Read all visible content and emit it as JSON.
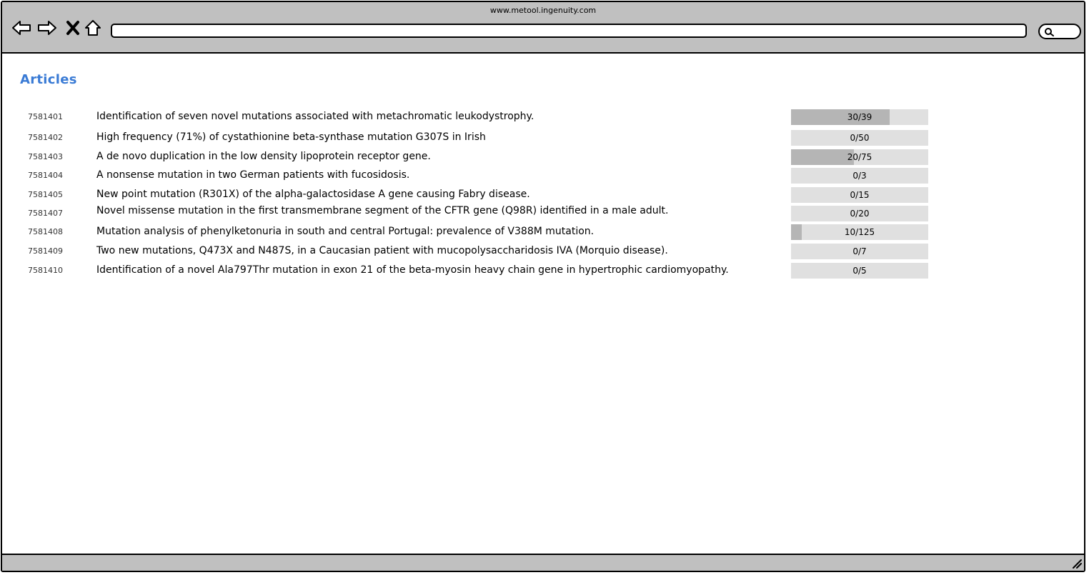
{
  "browser": {
    "url_caption": "www.metool.ingenuity.com",
    "address_value": "",
    "icons": [
      "back-arrow-icon",
      "forward-arrow-icon",
      "stop-icon",
      "home-icon",
      "search-icon",
      "resize-grip-icon"
    ]
  },
  "page": {
    "heading": "Articles",
    "heading_color": "#3a7bd5"
  },
  "articles": [
    {
      "id": "7581401",
      "title": "Identification of seven novel mutations associated with metachromatic leukodystrophy.",
      "progress_label": "30/39",
      "progress_fraction": 0.72
    },
    {
      "id": "7581402",
      "title": "High frequency (71%) of cystathionine beta-synthase mutation G307S in Irish",
      "progress_label": "0/50",
      "progress_fraction": 0
    },
    {
      "id": "7581403",
      "title": "A de novo duplication in the low density lipoprotein receptor gene.",
      "progress_label": "20/75",
      "progress_fraction": 0.46
    },
    {
      "id": "7581404",
      "title": "A nonsense mutation in two German patients with fucosidosis.",
      "progress_label": "0/3",
      "progress_fraction": 0
    },
    {
      "id": "7581405",
      "title": "New point mutation (R301X) of the alpha-galactosidase A gene causing Fabry disease.",
      "progress_label": "0/15",
      "progress_fraction": 0
    },
    {
      "id": "7581407",
      "title": "Novel missense mutation in the first transmembrane segment of the CFTR gene (Q98R) identified in a male adult.",
      "progress_label": "0/20",
      "progress_fraction": 0
    },
    {
      "id": "7581408",
      "title": "Mutation analysis of phenylketonuria in south and central Portugal: prevalence of V388M mutation.",
      "progress_label": "10/125",
      "progress_fraction": 0.08
    },
    {
      "id": "7581409",
      "title": "Two new mutations, Q473X and N487S, in a Caucasian patient with mucopolysaccharidosis IVA (Morquio disease).",
      "progress_label": "0/7",
      "progress_fraction": 0
    },
    {
      "id": "7581410",
      "title": "Identification of a novel Ala797Thr mutation in exon 21 of the beta-myosin heavy chain gene in hypertrophic cardiomyopathy.",
      "progress_label": "0/5",
      "progress_fraction": 0
    }
  ]
}
